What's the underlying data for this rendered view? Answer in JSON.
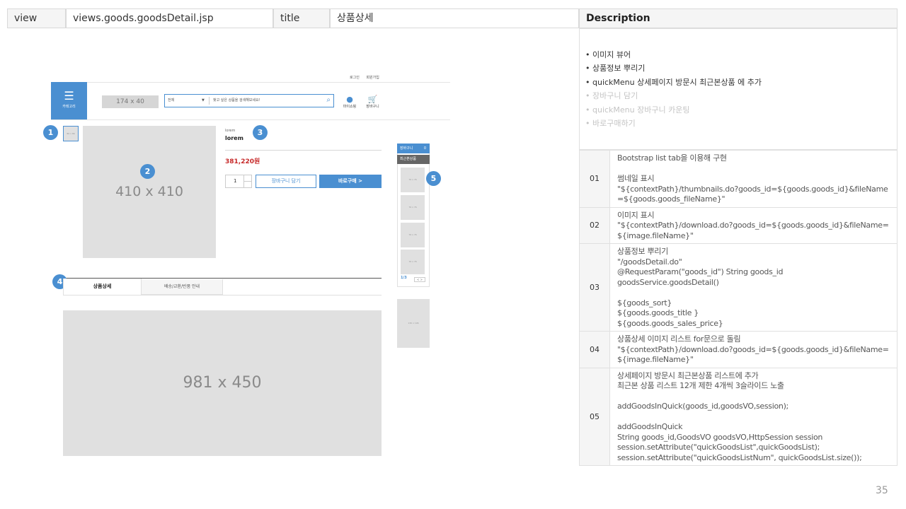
{
  "header": {
    "view_label": "view",
    "view_value": "views.goods.goodsDetail.jsp",
    "title_label": "title",
    "title_value": "상품상세",
    "description_label": "Description"
  },
  "wireframe": {
    "top_links": [
      "로그인",
      "회원가입"
    ],
    "category_label": "카테고리",
    "logo_placeholder": "174 x 40",
    "search_select": "전체",
    "search_placeholder": "찾고 싶은 상품을 검색해보세요!",
    "user_menu": [
      "마이쇼핑",
      "장바구니"
    ],
    "thumb_placeholder": "86 x 86",
    "main_image": "410 x 410",
    "product_category": "lorem",
    "product_name": "lorem",
    "price": "381,220원",
    "quantity": "1",
    "cart_button": "장바구니 담기",
    "buy_button": "바로구매 >",
    "quick_header": "장바구니",
    "quick_count": "0",
    "quick_sub": "최근본상품",
    "quick_item_placeholder": "76 x 76",
    "quick_page": "1/3",
    "quick_arrows": "< >",
    "banner_placeholder": "130 x 196",
    "tabs": [
      "상품상세",
      "배송/교환/반품 안내"
    ],
    "detail_image": "981 x 450",
    "badges": [
      "1",
      "2",
      "3",
      "4",
      "5"
    ]
  },
  "description": {
    "bullets": [
      "이미지 뷰어",
      "상품정보 뿌리기",
      "quickMenu 상세페이지 방문시 최근본상품 에 추가",
      "장바구니 담기",
      "quickMenu 장바구니 카운팅",
      "바로구매하기"
    ],
    "rows": [
      {
        "num": "01",
        "lines": [
          "Bootstrap list tab을 이용해 구현",
          "",
          "썸네일 표시",
          "\"${contextPath}/thumbnails.do?goods_id=${goods.goods_id}&fileName",
          "=${goods.goods_fileName}\""
        ]
      },
      {
        "num": "02",
        "lines": [
          "이미지 표시",
          "\"${contextPath}/download.do?goods_id=${goods.goods_id}&fileName=",
          "${image.fileName}\""
        ]
      },
      {
        "num": "03",
        "lines": [
          "상품정보 뿌리기",
          "\"/goodsDetail.do\"",
          "@RequestParam(\"goods_id\") String goods_id",
          "goodsService.goodsDetail()",
          "",
          "${goods_sort}",
          "${goods.goods_title }",
          "${goods.goods_sales_price}"
        ]
      },
      {
        "num": "04",
        "lines": [
          "상품상세 이미지 리스트 for문으로 돌림",
          "\"${contextPath}/download.do?goods_id=${goods.goods_id}&fileName=",
          "${image.fileName}\""
        ]
      },
      {
        "num": "05",
        "lines": [
          "상세페이지 방문시 최근본상품 리스트에 추가",
          "최근본 상품 리스트 12개 제한 4개씩 3슬라이드 노출",
          "",
          "addGoodsInQuick(goods_id,goodsVO,session);",
          "",
          "addGoodsInQuick",
          "String goods_id,GoodsVO goodsVO,HttpSession session",
          "session.setAttribute(\"quickGoodsList\",quickGoodsList);",
          "session.setAttribute(\"quickGoodsListNum\", quickGoodsList.size());"
        ]
      }
    ]
  },
  "page_number": "35"
}
